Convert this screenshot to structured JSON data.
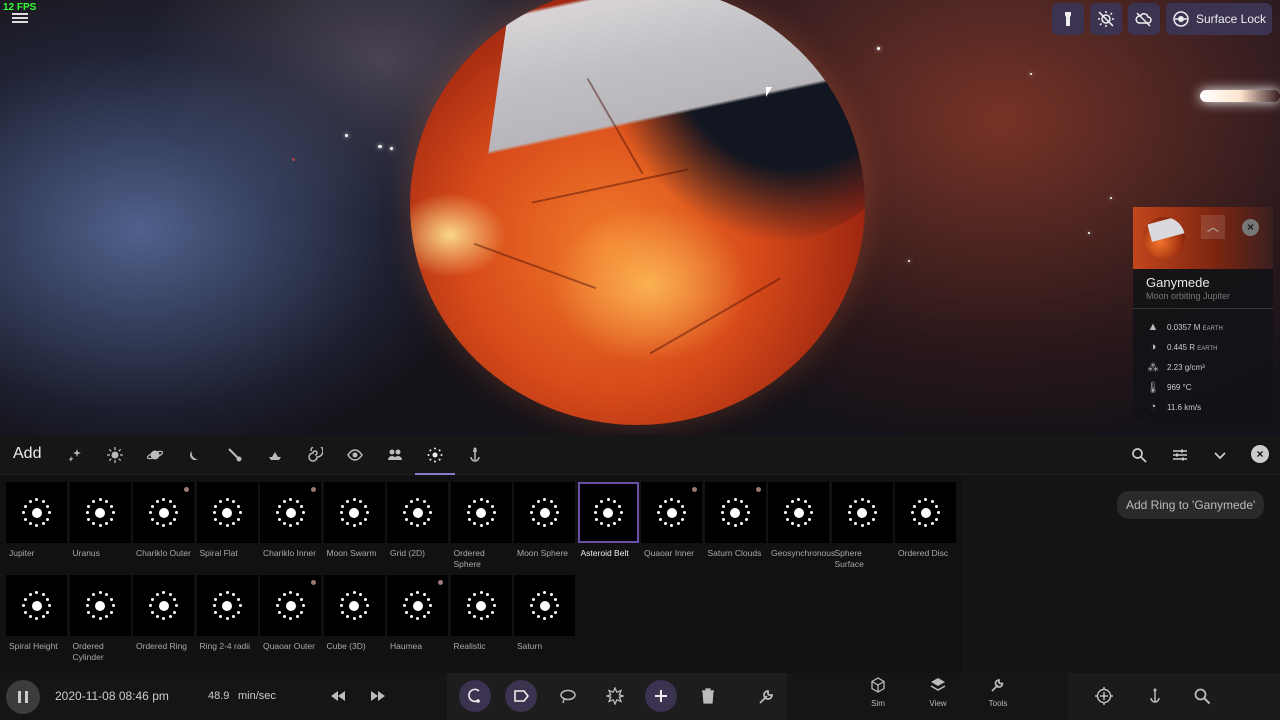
{
  "hud": {
    "fps": "12 FPS",
    "surface_lock_label": "Surface Lock"
  },
  "object_info": {
    "name": "Ganymede",
    "subtitle": "Moon orbiting Jupiter",
    "mass_value": "0.0357 M",
    "mass_unit": "EARTH",
    "radius_value": "0.445 R",
    "radius_unit": "EARTH",
    "density": "2.23 g/cm³",
    "temperature": "969 °C",
    "velocity": "11.6 km/s"
  },
  "add_panel": {
    "title": "Add",
    "tooltip": "Add Ring to 'Ganymede'",
    "items": [
      {
        "label": "Jupiter",
        "dot": false
      },
      {
        "label": "Uranus",
        "dot": false
      },
      {
        "label": "Chariklo Outer",
        "dot": true
      },
      {
        "label": "Spiral Flat",
        "dot": false
      },
      {
        "label": "Chariklo Inner",
        "dot": true
      },
      {
        "label": "Moon Swarm",
        "dot": false
      },
      {
        "label": "Grid (2D)",
        "dot": false
      },
      {
        "label": "Ordered Sphere",
        "dot": false
      },
      {
        "label": "Moon Sphere",
        "dot": false
      },
      {
        "label": "Asteroid Belt",
        "dot": false,
        "selected": true
      },
      {
        "label": "Quaoar Inner",
        "dot": true
      },
      {
        "label": "Saturn Clouds",
        "dot": true
      },
      {
        "label": "Geosynchronous",
        "dot": false
      },
      {
        "label": "Sphere Surface",
        "dot": false
      },
      {
        "label": "Ordered Disc",
        "dot": false
      },
      {
        "label": "Spiral Height",
        "dot": false
      },
      {
        "label": "Ordered Cylinder",
        "dot": false
      },
      {
        "label": "Ordered Ring",
        "dot": false
      },
      {
        "label": "Ring 2-4 radii",
        "dot": false
      },
      {
        "label": "Quaoar Outer",
        "dot": true
      },
      {
        "label": "Cube (3D)",
        "dot": false
      },
      {
        "label": "Haumea",
        "dot": true
      },
      {
        "label": "Realistic",
        "dot": false
      },
      {
        "label": "Saturn",
        "dot": false
      }
    ]
  },
  "bottom_bar": {
    "date": "2020-11-08 08:46 pm",
    "rate": "48.9",
    "rate_unit": "min/sec",
    "sim_label": "Sim",
    "view_label": "View",
    "tools_label": "Tools"
  },
  "colors": {
    "accent": "#3b3350",
    "selection": "#6b4fa8",
    "fps_text": "#33ff33"
  }
}
